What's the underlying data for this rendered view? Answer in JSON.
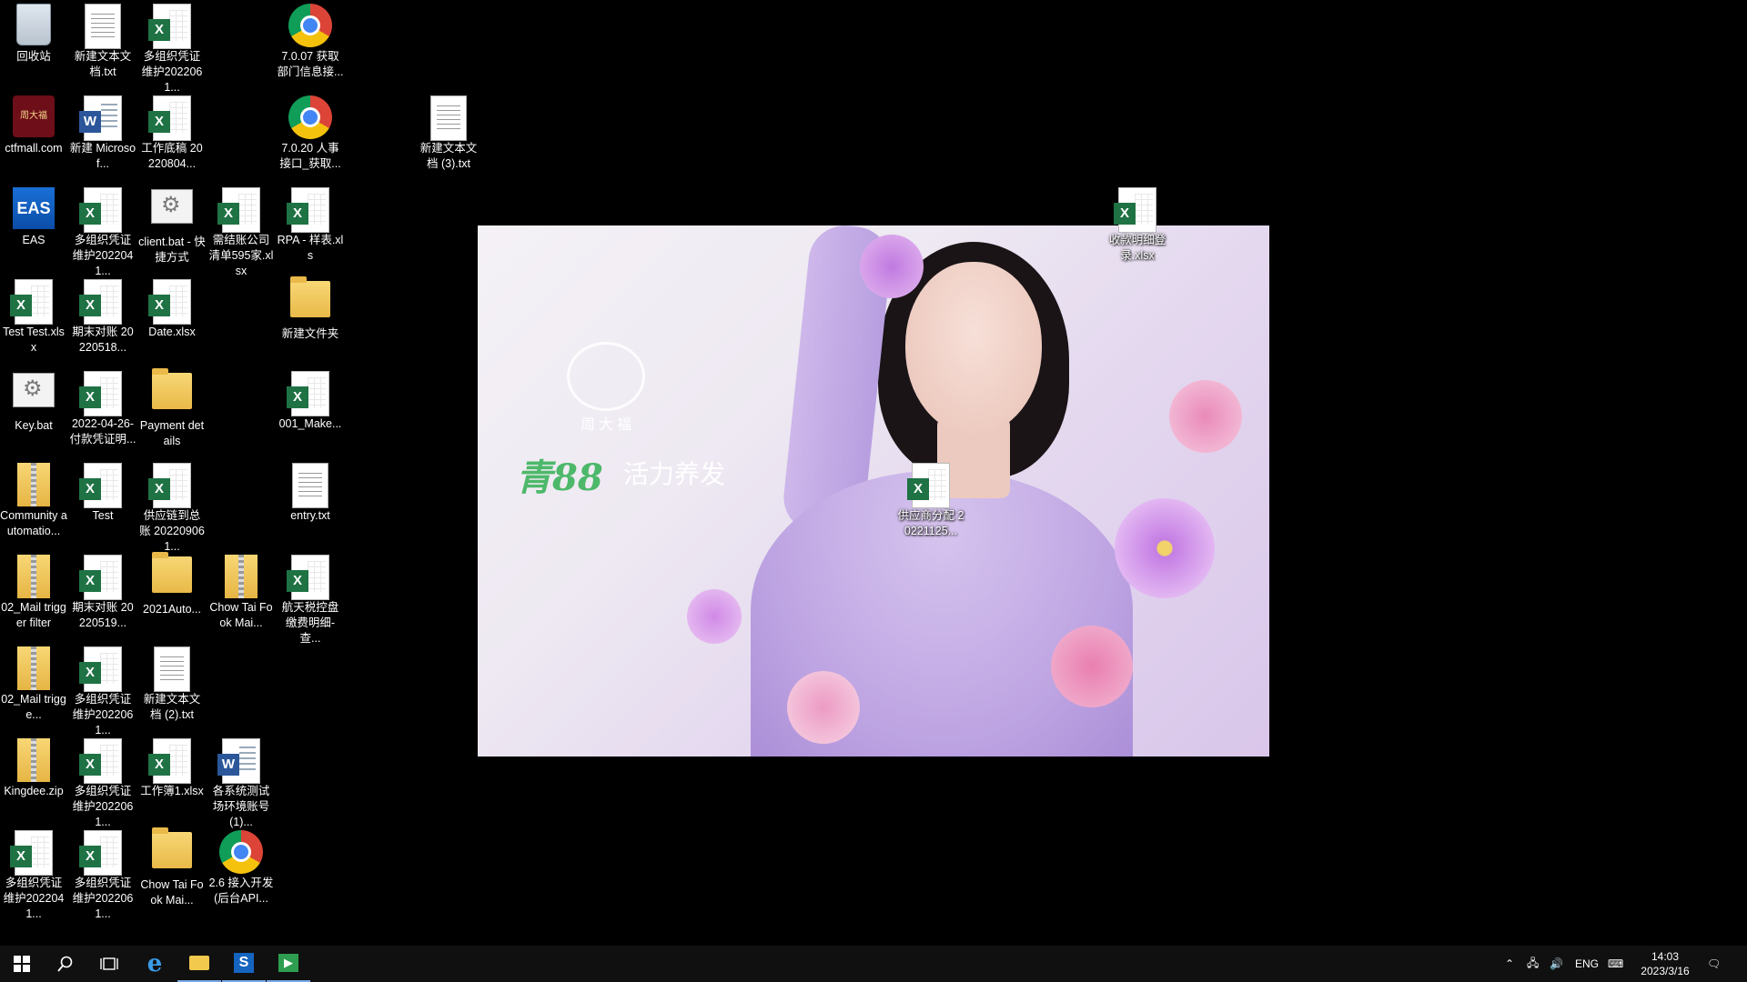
{
  "desktop": {
    "icons": [
      {
        "label": "回收站",
        "type": "recycle"
      },
      {
        "label": "新建文本文档.txt",
        "type": "txt"
      },
      {
        "label": "多组织凭证维护2022061...",
        "type": "excel"
      },
      {
        "label": "7.0.07 获取部门信息接...",
        "type": "chrome"
      },
      {
        "label": "ctfmall.com",
        "type": "ctf"
      },
      {
        "label": "新建 Microsof...",
        "type": "word"
      },
      {
        "label": "工作底稿 20220804...",
        "type": "excel"
      },
      {
        "label": "7.0.20 人事接口_获取...",
        "type": "chrome"
      },
      {
        "label": "新建文本文档 (3).txt",
        "type": "txt"
      },
      {
        "label": "EAS",
        "type": "eas"
      },
      {
        "label": "多组织凭证维护2022041...",
        "type": "excel"
      },
      {
        "label": "client.bat - 快捷方式",
        "type": "bat"
      },
      {
        "label": "需结账公司清单595家.xlsx",
        "type": "excel"
      },
      {
        "label": "RPA - 样表.xls",
        "type": "excel"
      },
      {
        "label": "收款明细登录.xlsx",
        "type": "excel"
      },
      {
        "label": "Test Test.xlsx",
        "type": "excel"
      },
      {
        "label": "期末对账 20220518...",
        "type": "excel"
      },
      {
        "label": "Date.xlsx",
        "type": "excel"
      },
      {
        "label": "新建文件夹",
        "type": "folder"
      },
      {
        "label": "Key.bat",
        "type": "bat"
      },
      {
        "label": "2022-04-26-付款凭证明...",
        "type": "excel"
      },
      {
        "label": "Payment details",
        "type": "folder"
      },
      {
        "label": "001_Make...",
        "type": "excel"
      },
      {
        "label": "Community automatio...",
        "type": "zip"
      },
      {
        "label": "Test",
        "type": "excel"
      },
      {
        "label": "供应链到总账 202209061...",
        "type": "excel"
      },
      {
        "label": "entry.txt",
        "type": "txt"
      },
      {
        "label": "02_Mail trigger filter",
        "type": "zip"
      },
      {
        "label": "期末对账 20220519...",
        "type": "excel"
      },
      {
        "label": "2021Auto...",
        "type": "folder"
      },
      {
        "label": "Chow Tai Fook Mai...",
        "type": "zip"
      },
      {
        "label": "航天税控盘缴费明细-查...",
        "type": "excel"
      },
      {
        "label": "02_Mail trigge...",
        "type": "zip"
      },
      {
        "label": "多组织凭证维护2022061...",
        "type": "excel"
      },
      {
        "label": "新建文本文档 (2).txt",
        "type": "txt"
      },
      {
        "label": "Kingdee.zip",
        "type": "zip"
      },
      {
        "label": "多组织凭证维护2022061...",
        "type": "excel"
      },
      {
        "label": "工作簿1.xlsx",
        "type": "excel"
      },
      {
        "label": "各系统测试场环境账号(1)...",
        "type": "word"
      },
      {
        "label": "多组织凭证维护2022041...",
        "type": "excel"
      },
      {
        "label": "多组织凭证维护2022061...",
        "type": "excel"
      },
      {
        "label": "Chow Tai Fook Mai...",
        "type": "folder"
      },
      {
        "label": "2.6 接入开发(后台API...",
        "type": "chrome"
      },
      {
        "label": "供应商分配 20221125...",
        "type": "excel"
      }
    ],
    "wallpaper": {
      "logo_text": "周大福",
      "brand": "青88",
      "slogan": "活力养发"
    }
  },
  "taskbar": {
    "language": "ENG",
    "time": "14:03",
    "date": "2023/3/16"
  }
}
